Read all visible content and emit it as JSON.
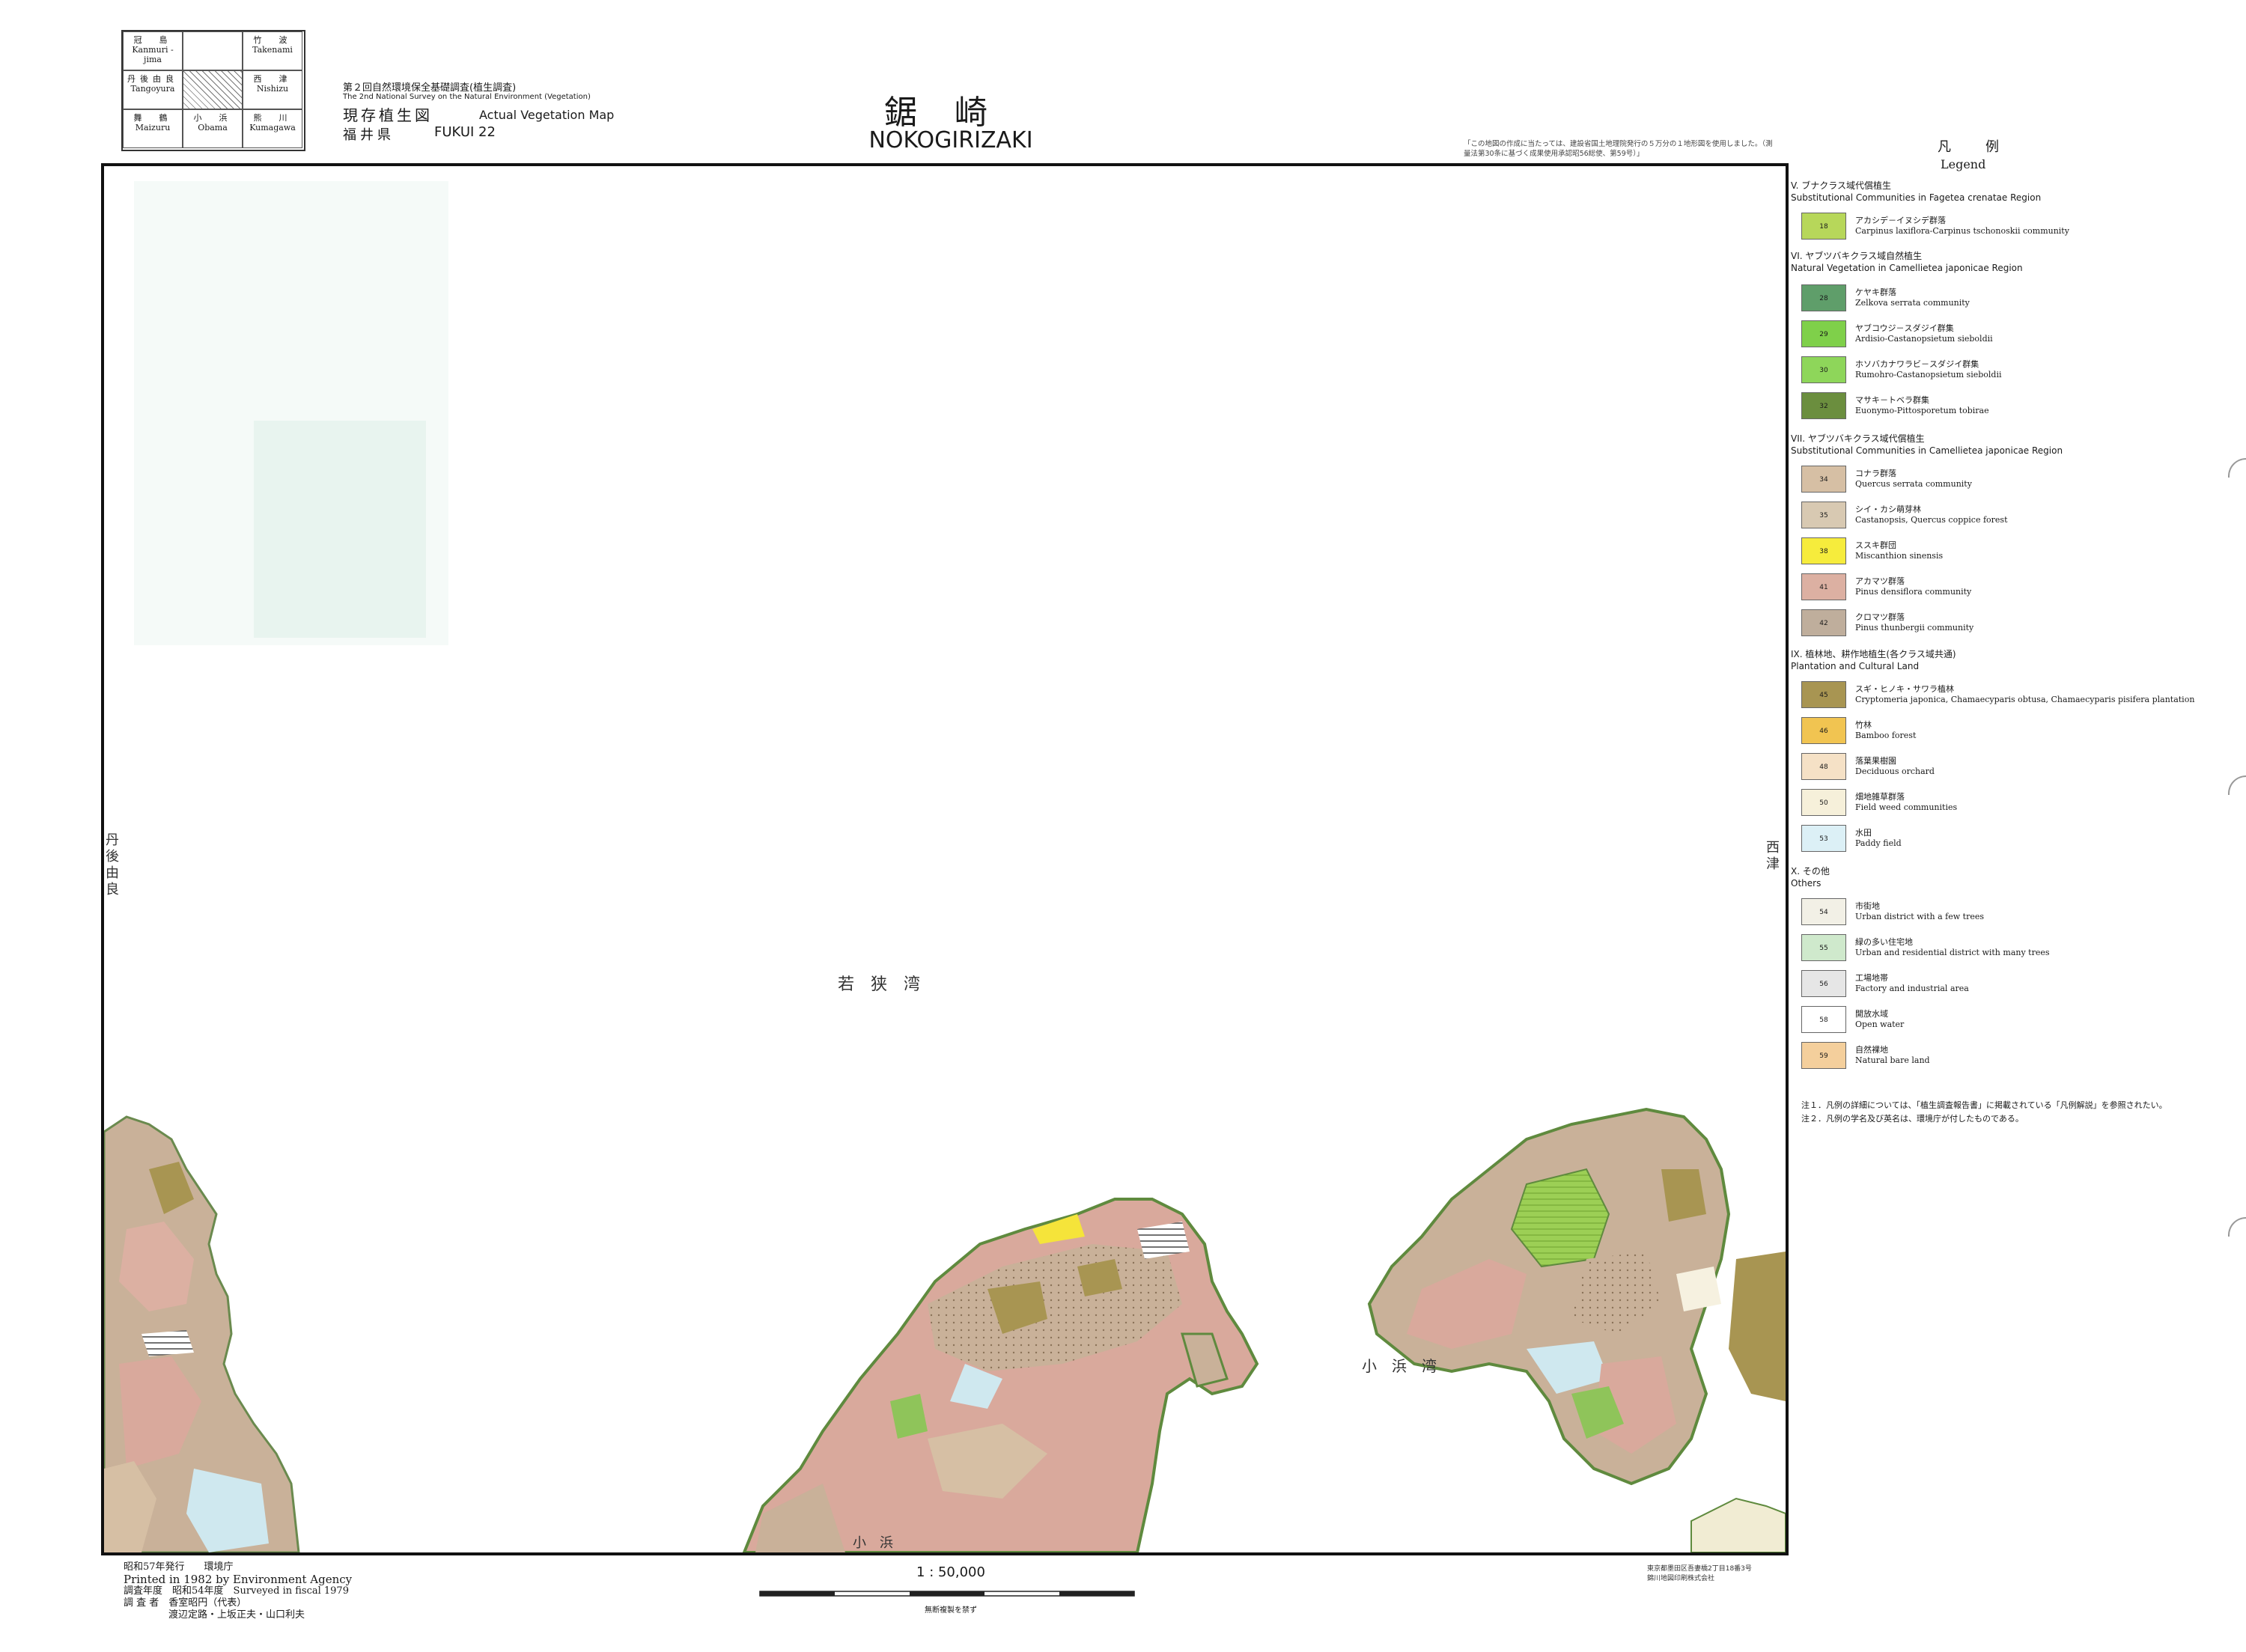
{
  "index_grid": [
    {
      "jp": "冠　島",
      "en": "Kanmuri -jima"
    },
    {
      "jp": "",
      "en": ""
    },
    {
      "jp": "竹　波",
      "en": "Takenami"
    },
    {
      "jp": "丹後由良",
      "en": "Tangoyura"
    },
    {
      "jp": "",
      "en": ""
    },
    {
      "jp": "西　津",
      "en": "Nishizu"
    },
    {
      "jp": "舞　鶴",
      "en": "Maizuru"
    },
    {
      "jp": "小　浜",
      "en": "Obama"
    },
    {
      "jp": "熊　川",
      "en": "Kumagawa"
    }
  ],
  "header": {
    "survey_jp": "第２回自然環境保全基礎調査(植生調査)",
    "survey_en": "The 2nd National Survey on the Natural Environment (Vegetation)",
    "map_type_jp": "現存植生図",
    "map_type_en": "Actual Vegetation Map",
    "prefecture_jp": "福井県",
    "sheet_code": "FUKUI 22",
    "title_jp": "鋸崎",
    "title_en": "NOKOGIRIZAKI",
    "data_note": "「この地図の作成に当たっては、建設省国土地理院発行の５万分の１地形図を使用しました。（測量法第30条に基づく成果使用承認昭56総使、第59号）」"
  },
  "map": {
    "bay_label_1": "若　狭　湾",
    "bay_label_2": "小　浜　湾",
    "left_edge": "丹後由良",
    "right_edge": "西津",
    "bottom_center": "小　浜",
    "coast_colors": {
      "water": "#eef6f2",
      "konara": "#c9b199",
      "akamatsu": "#d9a99c",
      "field": "#f1ecd3",
      "green_forest": "#8fc45a",
      "dark_forest": "#6a8a4e",
      "paddy": "#cfe8ef",
      "urban": "#f6f1e0",
      "susuki": "#f5e43a"
    }
  },
  "legend": {
    "head_jp": "凡　例",
    "head_en": "Legend",
    "sections": [
      {
        "jp": "V. ブナクラス域代償植生",
        "en": "Substitutional Communities in Fagetea crenatae Region"
      },
      {
        "jp": "VI. ヤブツバキクラス域自然植生",
        "en": "Natural Vegetation in Camellietea japonicae Region"
      },
      {
        "jp": "VII. ヤブツバキクラス域代償植生",
        "en": "Substitutional Communities in Camellietea japonicae Region"
      },
      {
        "jp": "IX. 植林地、耕作地植生(各クラス域共通)",
        "en": "Plantation and Cultural Land"
      },
      {
        "jp": "X. その他",
        "en": "Others"
      }
    ],
    "items": [
      {
        "code": "18",
        "jp": "アカシデ－イヌシデ群落",
        "en": "Carpinus laxiflora-Carpinus tschonoskii community",
        "color": "#b7d75a"
      },
      {
        "code": "28",
        "jp": "ケヤキ群落",
        "en": "Zelkova serrata community",
        "color": "#5f9e6a"
      },
      {
        "code": "29",
        "jp": "ヤブコウジ－スダジイ群集",
        "en": "Ardisio-Castanopsietum sieboldii",
        "color": "#7fd04a"
      },
      {
        "code": "30",
        "jp": "ホソバカナワラビ－スダジイ群集",
        "en": "Rumohro-Castanopsietum sieboldii",
        "color": "#8ed65a"
      },
      {
        "code": "32",
        "jp": "マサキ－トベラ群集",
        "en": "Euonymo-Pittosporetum tobirae",
        "color": "#6b8e3e"
      },
      {
        "code": "34",
        "jp": "コナラ群落",
        "en": "Quercus serrata community",
        "color": "#d6bfa4"
      },
      {
        "code": "35",
        "jp": "シイ・カシ萌芽林",
        "en": "Castanopsis, Quercus coppice forest",
        "color": "#d8c9b2"
      },
      {
        "code": "38",
        "jp": "ススキ群団",
        "en": "Miscanthion sinensis",
        "color": "#f6ec3c"
      },
      {
        "code": "41",
        "jp": "アカマツ群落",
        "en": "Pinus densiflora community",
        "color": "#dcb0a2"
      },
      {
        "code": "42",
        "jp": "クロマツ群落",
        "en": "Pinus thunbergii community",
        "color": "#bfae9c"
      },
      {
        "code": "45",
        "jp": "スギ・ヒノキ・サワラ植林",
        "en": "Cryptomeria japonica, Chamaecyparis obtusa, Chamaecyparis pisifera plantation",
        "color": "#a89552"
      },
      {
        "code": "46",
        "jp": "竹林",
        "en": "Bamboo forest",
        "color": "#f1c451"
      },
      {
        "code": "48",
        "jp": "落葉果樹園",
        "en": "Deciduous orchard",
        "color": "#f5e1c6"
      },
      {
        "code": "50",
        "jp": "畑地雑草群落",
        "en": "Field weed communities",
        "color": "#f6f0da"
      },
      {
        "code": "53",
        "jp": "水田",
        "en": "Paddy field",
        "color": "#dcf0f6"
      },
      {
        "code": "54",
        "jp": "市街地",
        "en": "Urban district with a few trees",
        "color": "#f2f0e6"
      },
      {
        "code": "55",
        "jp": "緑の多い住宅地",
        "en": "Urban and residential district with many trees",
        "color": "#cfe9cc"
      },
      {
        "code": "56",
        "jp": "工場地帯",
        "en": "Factory and industrial area",
        "color": "#e6e6e6"
      },
      {
        "code": "58",
        "jp": "開放水域",
        "en": "Open water",
        "color": "#ffffff"
      },
      {
        "code": "59",
        "jp": "自然裸地",
        "en": "Natural bare land",
        "color": "#f4cf9c"
      }
    ],
    "notes": [
      "注１．凡例の詳細については、「植生調査報告書」に掲載されている「凡例解説」を参照されたい。",
      "注２．凡例の学名及び英名は、環境庁が付したものである。"
    ]
  },
  "footer": {
    "issued_jp": "昭和57年発行　　環境庁",
    "issued_en": "Printed in 1982 by Environment Agency",
    "survey_year": "調査年度　昭和54年度　Surveyed in fiscal 1979",
    "surveyors_1": "調 査 者　香室昭円（代表）",
    "surveyors_2": "渡辺定路・上坂正夫・山口利夫",
    "scale": "1 : 50,000",
    "scale_note": "無断複製を禁ず",
    "publisher_1": "東京都墨田区吾妻橋2丁目18番3号",
    "publisher_2": "錦川地図印刷株式会社"
  }
}
